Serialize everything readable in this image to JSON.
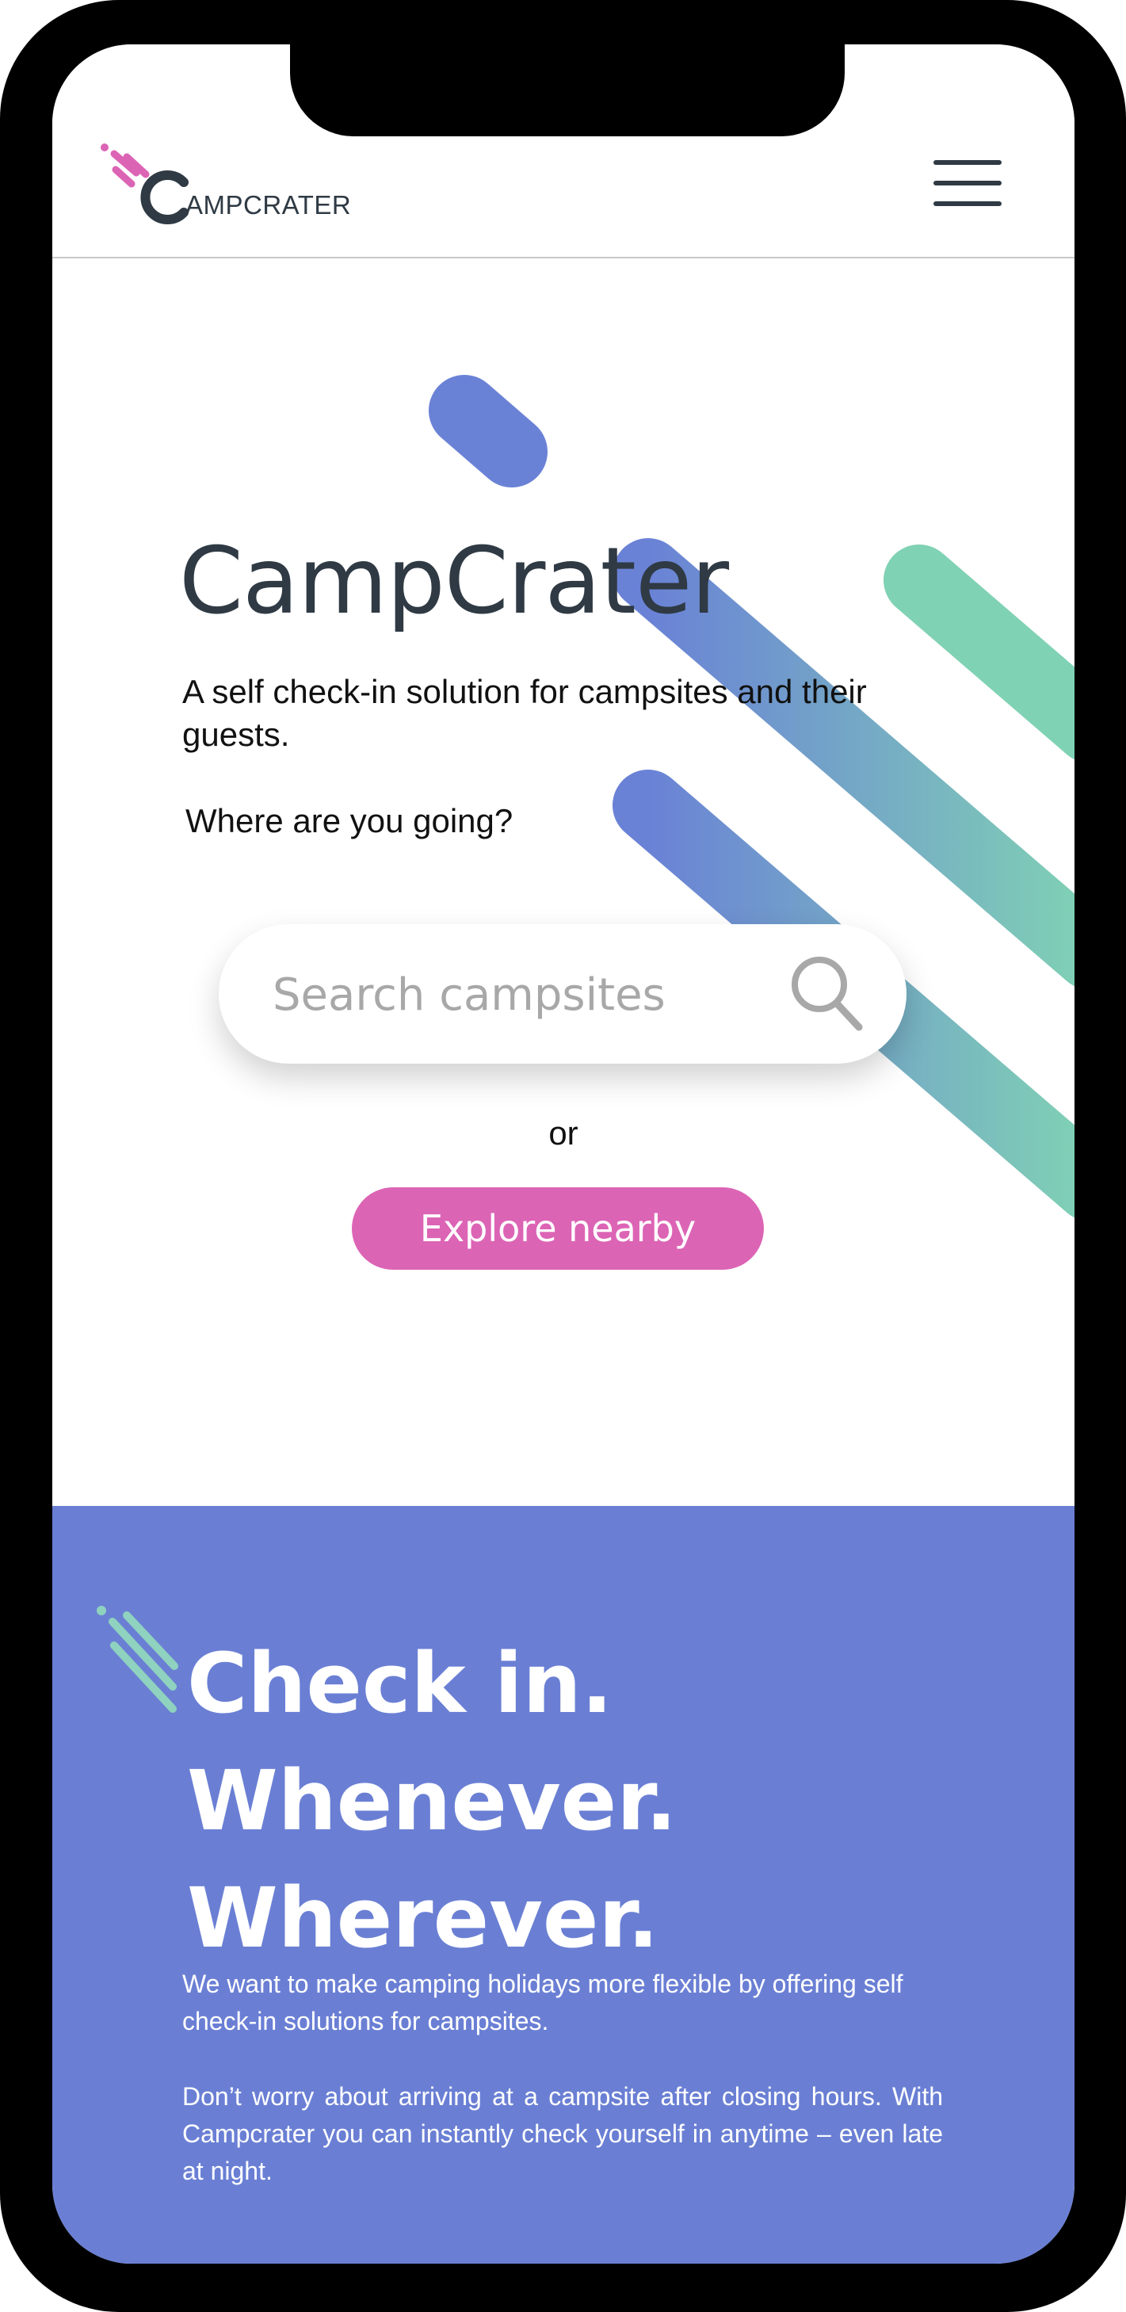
{
  "header": {
    "logo_text": "AMPCRATER",
    "logo_icon": "campcrater-logo-icon",
    "menu_icon": "hamburger-menu-icon"
  },
  "hero": {
    "title": "CampCrater",
    "subtitle": "A self check-in solution for campsites and their guests.",
    "where_label": "Where are you going?",
    "search_placeholder": "Search campsites",
    "search_icon": "search-icon",
    "or_label": "or",
    "explore_label": "Explore nearby"
  },
  "info": {
    "headline_line1": "Check in. Whenever.",
    "headline_line2": "Wherever.",
    "paragraph1": "We want to make camping holidays more flexible by offering self check-in solutions for campsites.",
    "paragraph2": "Don’t worry about arriving at a campsite after closing hours. With Campcrater you can instantly check yourself in anytime – even late at night."
  },
  "colors": {
    "accent_pink": "#dc64b5",
    "section_blue": "#6a7fd4",
    "stripe_blue": "#6a82d6",
    "stripe_green": "#80d2b4",
    "text_dark": "#2f3a44"
  }
}
